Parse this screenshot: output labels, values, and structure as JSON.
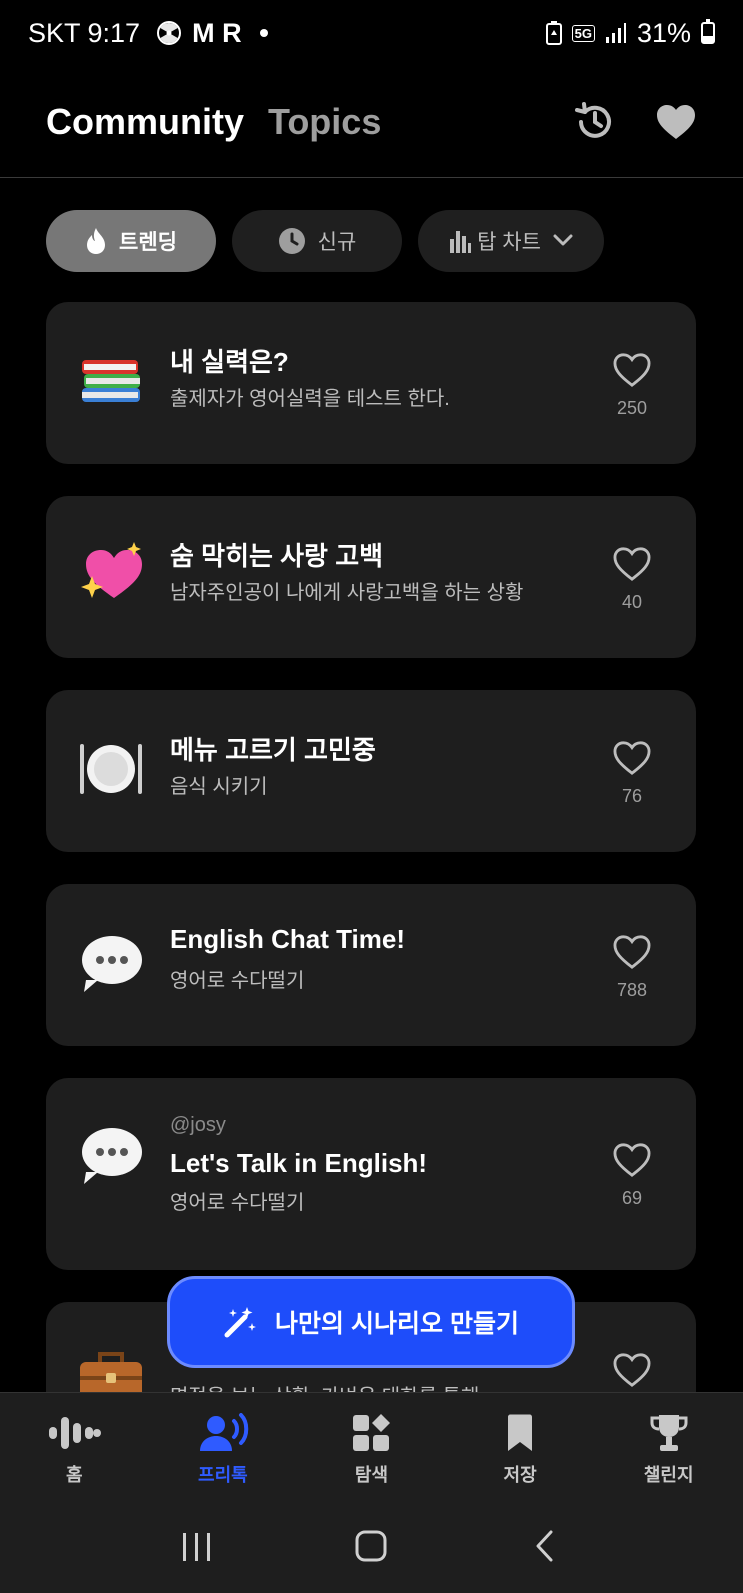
{
  "status_bar": {
    "carrier_time": "SKT 9:17",
    "indicators": "M R",
    "network": "5G",
    "battery": "31%"
  },
  "header": {
    "tab_active": "Community",
    "tab_inactive": "Topics",
    "icons": [
      "history-icon",
      "heart-icon"
    ]
  },
  "filters": [
    {
      "label": "트렌딩",
      "icon": "flame-icon",
      "active": true
    },
    {
      "label": "신규",
      "icon": "clock-icon",
      "active": false
    },
    {
      "label": "탑 차트",
      "icon": "bar-chart-icon",
      "active": false
    }
  ],
  "cards": [
    {
      "emoji": "📚",
      "author": "",
      "title": "내 실력은?",
      "description": "출제자가 영어실력을 테스트 한다.",
      "likes": "250"
    },
    {
      "emoji": "💖",
      "author": "",
      "title": "숨 막히는 사랑 고백",
      "description": "남자주인공이 나에게 사랑고백을 하는 상황",
      "likes": "40"
    },
    {
      "emoji": "🍽️",
      "author": "",
      "title": "메뉴 고르기 고민중",
      "description": "음식 시키기",
      "likes": "76"
    },
    {
      "emoji": "💬",
      "author": "",
      "title": "English Chat Time!",
      "description": "영어로 수다떨기",
      "likes": "788"
    },
    {
      "emoji": "💬",
      "author": "@josy",
      "title": "Let's Talk in English!",
      "description": "영어로 수다떨기",
      "likes": "69"
    },
    {
      "emoji": "💼",
      "author": "",
      "title": "",
      "description": "면접을 보는 상황. 가벼운 대화를 통해",
      "likes": ""
    }
  ],
  "fab": {
    "label": "나만의 시나리오 만들기",
    "icon": "magic-wand-icon"
  },
  "bottom_nav": [
    {
      "label": "홈",
      "icon": "waveform-icon",
      "active": false
    },
    {
      "label": "프리톡",
      "icon": "person-speaking-icon",
      "active": true
    },
    {
      "label": "탐색",
      "icon": "grid-shapes-icon",
      "active": false
    },
    {
      "label": "저장",
      "icon": "bookmark-icon",
      "active": false
    },
    {
      "label": "챌린지",
      "icon": "trophy-icon",
      "active": false
    }
  ],
  "colors": {
    "accent": "#1E4DFA",
    "background": "#000000",
    "card": "#1E1E1E",
    "active_chip": "#777777"
  }
}
